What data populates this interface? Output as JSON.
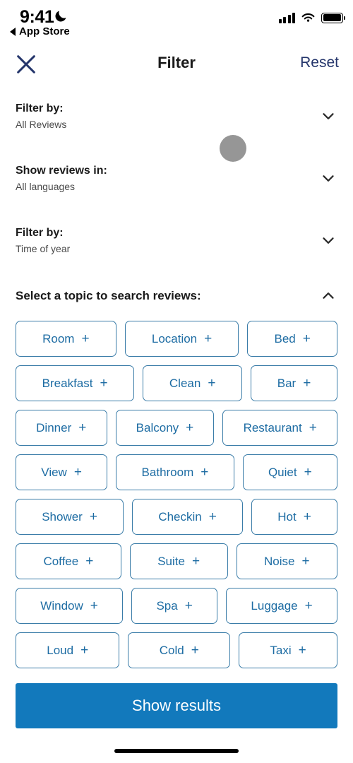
{
  "status_bar": {
    "time": "9:41",
    "moon_icon": "moon-icon",
    "back_label": "App Store",
    "signal_icon": "cellular-signal-icon",
    "wifi_icon": "wifi-icon",
    "battery_icon": "battery-full-icon"
  },
  "header": {
    "close_icon": "close-icon",
    "title": "Filter",
    "reset_label": "Reset"
  },
  "colors": {
    "cta_blue": "#1279bc",
    "chip_blue": "#1d6ca3",
    "chip_border": "#3a7ca8",
    "reset_navy": "#24356b",
    "cursor_gray": "#969696"
  },
  "sections": [
    {
      "title": "Filter by:",
      "value": "All Reviews",
      "chevron": "chevron-down-icon",
      "expanded": false
    },
    {
      "title": "Show reviews in:",
      "value": "All languages",
      "chevron": "chevron-down-icon",
      "expanded": false
    },
    {
      "title": "Filter by:",
      "value": "Time of year",
      "chevron": "chevron-down-icon",
      "expanded": false
    }
  ],
  "topics": {
    "title": "Select a topic to search reviews:",
    "chevron": "chevron-up-icon",
    "expanded": true,
    "suffix": "+",
    "rows": [
      [
        "Room",
        "Location",
        "Bed"
      ],
      [
        "Breakfast",
        "Clean",
        "Bar"
      ],
      [
        "Dinner",
        "Balcony",
        "Restaurant"
      ],
      [
        "View",
        "Bathroom",
        "Quiet"
      ],
      [
        "Shower",
        "Checkin",
        "Hot"
      ],
      [
        "Coffee",
        "Suite",
        "Noise"
      ],
      [
        "Window",
        "Spa",
        "Luggage"
      ],
      [
        "Loud",
        "Cold",
        "Taxi"
      ]
    ]
  },
  "footer": {
    "cta_label": "Show results"
  }
}
